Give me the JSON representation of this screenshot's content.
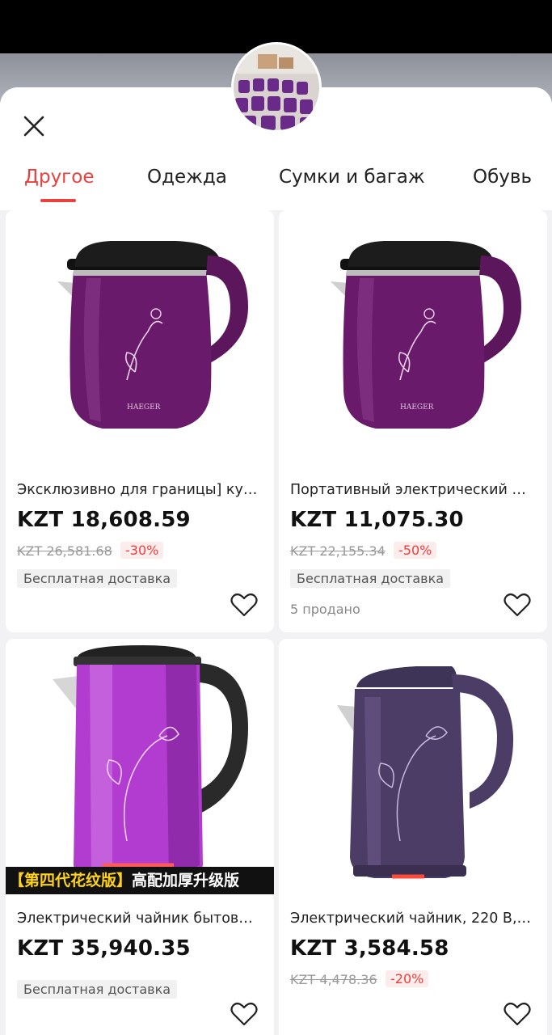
{
  "tabs": [
    {
      "label": "Другое"
    },
    {
      "label": "Одежда"
    },
    {
      "label": "Сумки и багаж"
    },
    {
      "label": "Обувь"
    }
  ],
  "colors": {
    "accent": "#e8413e",
    "kettle_purple": "#6a1a6a",
    "kettle_pink": "#b23ccf",
    "kettle_navy": "#4c3d66"
  },
  "products": [
    {
      "title": "Эксклюзивно для границы] кух...",
      "price": "KZT 18,608.59",
      "old_price": "KZT 26,581.68",
      "discount": "-30%",
      "shipping": "Бесплатная доставка",
      "brand": "HAEGER"
    },
    {
      "title": "Портативный электрический ч...",
      "price": "KZT 11,075.30",
      "old_price": "KZT 22,155.34",
      "discount": "-50%",
      "shipping": "Бесплатная доставка",
      "sold": "5 продано",
      "brand": "HAEGER"
    },
    {
      "title": "Электрический чайник бытово...",
      "price": "KZT 35,940.35",
      "shipping": "Бесплатная доставка",
      "promo_yellow": "【第四代花纹版】",
      "promo_white": "高配加厚升级版"
    },
    {
      "title": "Электрический чайник, 220 В, ...",
      "price": "KZT 3,584.58",
      "old_price": "KZT 4,478.36",
      "discount": "-20%"
    }
  ]
}
